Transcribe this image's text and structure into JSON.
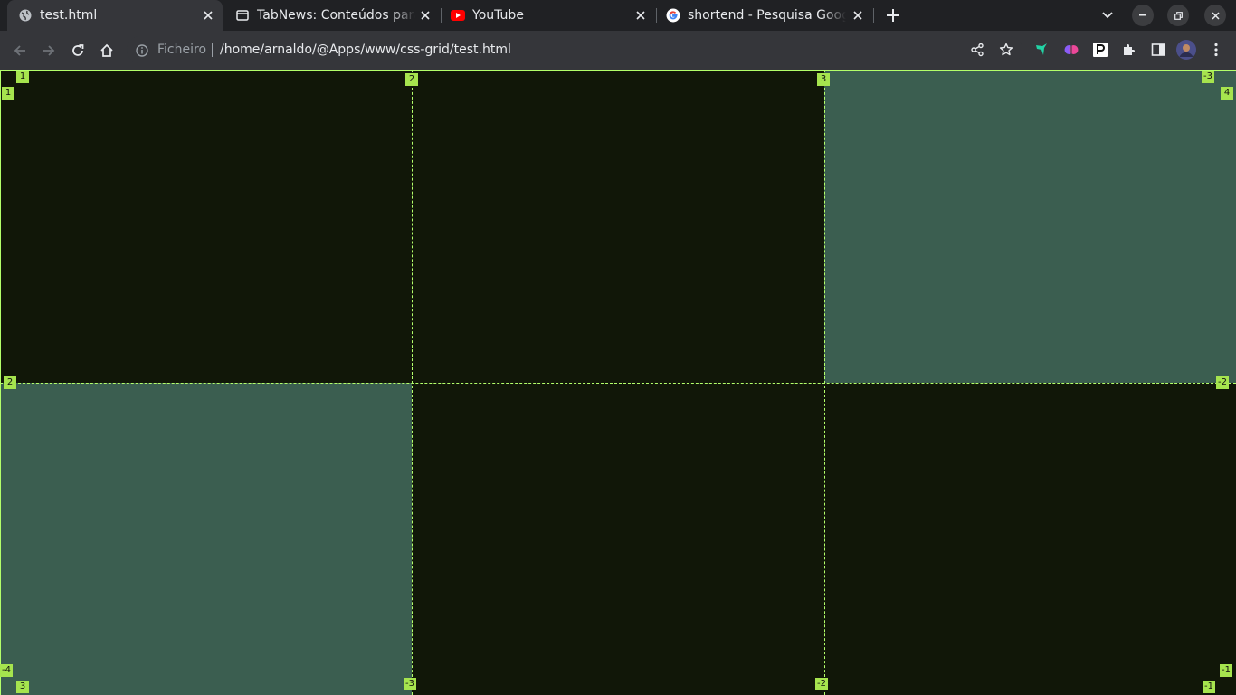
{
  "tabs": [
    {
      "title": "test.html",
      "favicon": "globe-icon",
      "active": true
    },
    {
      "title": "TabNews: Conteúdos para",
      "favicon": "page-icon",
      "active": false
    },
    {
      "title": "YouTube",
      "favicon": "youtube-icon",
      "active": false
    },
    {
      "title": "shortend - Pesquisa Google",
      "favicon": "google-icon",
      "active": false
    }
  ],
  "toolbar": {
    "scheme_label": "Ficheiro",
    "url": "/home/arnaldo/@Apps/www/css-grid/test.html"
  },
  "grid_overlay": {
    "line_color": "#b3ff6a",
    "badge_color": "#a6e44e",
    "cell_colors": {
      "dark": "#111708",
      "teal": "#3b5e50"
    },
    "column_labels_top": [
      "1",
      "2",
      "3",
      "-3",
      "4"
    ],
    "column_labels_bottom": [
      "3",
      "-3",
      "-2",
      "-1"
    ],
    "row_labels_left": [
      "1",
      "2",
      "-4"
    ],
    "row_labels_right": [
      "-2",
      "-1"
    ],
    "cells": [
      "dark",
      "dark",
      "teal",
      "teal",
      "dark",
      "dark"
    ]
  }
}
